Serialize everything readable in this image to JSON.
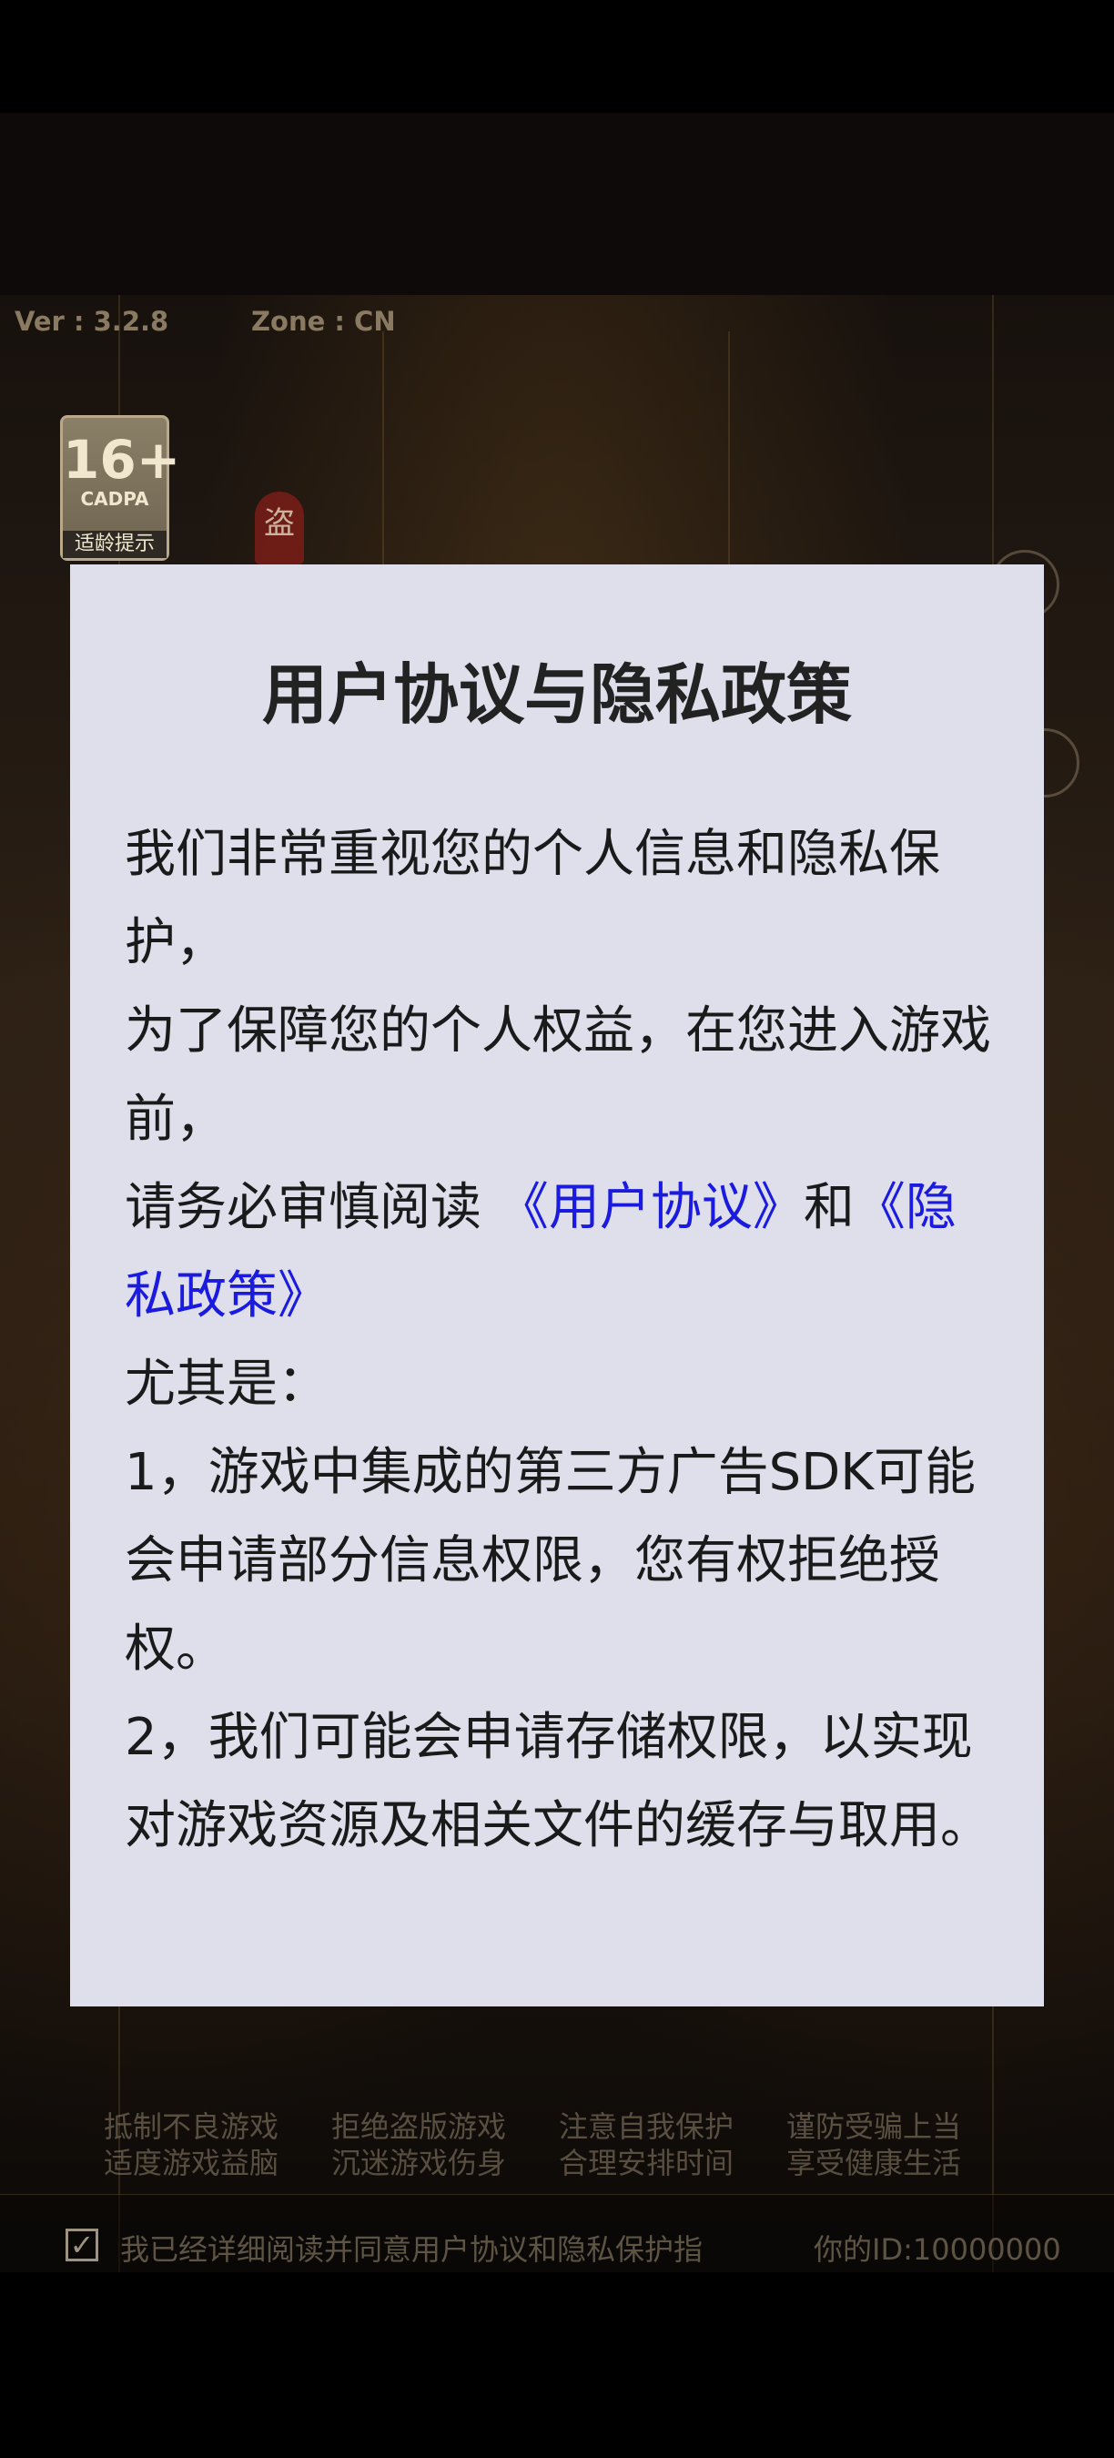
{
  "game": {
    "version": "Ver : 3.2.8",
    "zone": "Zone : CN",
    "age_badge": {
      "number": "16+",
      "org": "CADPA",
      "tip": "适龄提示"
    },
    "seal_char": "盗"
  },
  "dialog": {
    "title": "用户协议与隐私政策",
    "p1": "我们非常重视您的个人信息和隐私保护，",
    "p2": "为了保障您的个人权益，在您进入游戏前，",
    "p3_prefix": "请务必审慎阅读 ",
    "user_agreement_link": "《用户协议》",
    "p3_and": "和",
    "privacy_policy_link": "《隐私政策》",
    "p4": "尤其是：",
    "p5": "1，游戏中集成的第三方广告SDK可能会申请部分信息权限，您有权拒绝授权。",
    "p6": "2，我们可能会申请存储权限，以实现对游戏资源及相关文件的缓存与取用。"
  },
  "health_notice": {
    "row1": [
      "抵制不良游戏",
      "拒绝盗版游戏",
      "注意自我保护",
      "谨防受骗上当"
    ],
    "row2": [
      "适度游戏益脑",
      "沉迷游戏伤身",
      "合理安排时间",
      "享受健康生活"
    ]
  },
  "agreement": {
    "checked": true,
    "check_mark": "✓",
    "text": "我已经详细阅读并同意用户协议和隐私保护指引",
    "user_id": "你的ID:10000000"
  },
  "colors": {
    "link": "#1b1be0",
    "dialog_bg": "#dfdfec"
  }
}
